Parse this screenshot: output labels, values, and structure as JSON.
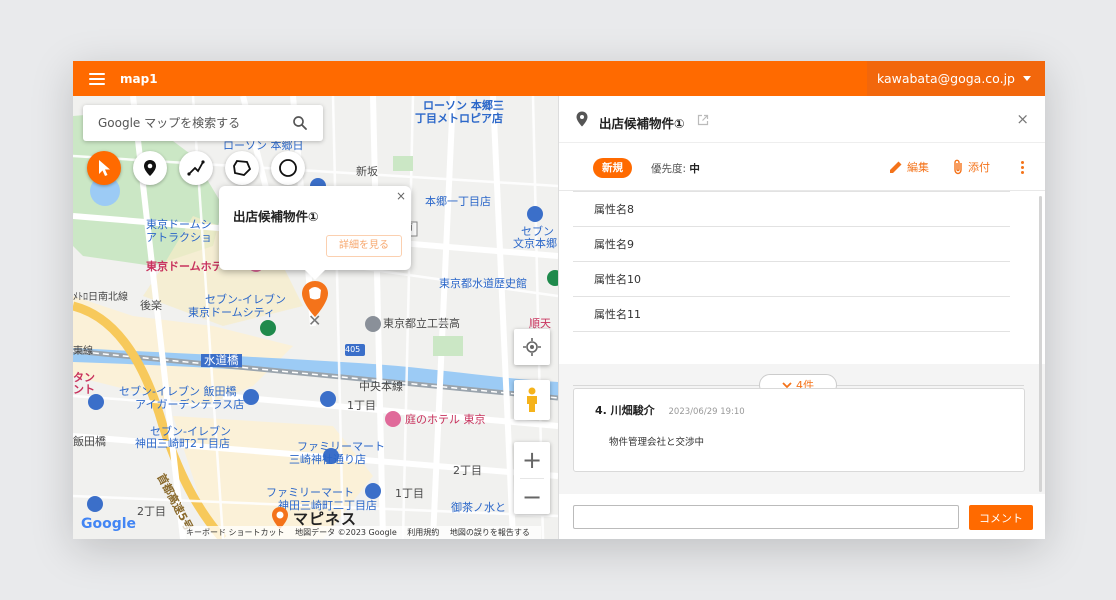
{
  "header": {
    "map_name": "map1",
    "user_email": "kawabata@goga.co.jp"
  },
  "map": {
    "search_placeholder": "Google マップを検索する",
    "tools": [
      "cursor-icon",
      "pin-icon",
      "polyline-icon",
      "polygon-icon",
      "circle-icon"
    ],
    "labels": [
      "ローソン 本郷三",
      "丁目メトロピア店",
      "ローソン 本郷日",
      "東京ドームシ",
      "アトラクショ",
      "東京ドームホテ",
      "新坂",
      "本郷一丁目店",
      "セブン",
      "文京本郷",
      "東京都水道歴史館",
      "後楽",
      "セブン-イレブン",
      "東京ドームシティ",
      "東京都立工芸高",
      "順天",
      "水道橋",
      "中央本線",
      "タン",
      "ント",
      "セブン-イレブン 飯田橋",
      "アイガーデンテラス店",
      "1丁目",
      "庭のホテル 東京",
      "セブン-イレブン",
      "神田三崎町2丁目店",
      "ファミリーマート",
      "三崎神社通り店",
      "2丁目",
      "ファミリーマート",
      "神田三崎町二丁目店",
      "1丁目",
      "首都高速5号",
      "2丁目",
      "御茶ノ水と",
      "飯田橋",
      "東線",
      "ﾒﾄﾛ日南北線",
      "番前",
      "405"
    ],
    "infowindow": {
      "title": "出店候補物件①",
      "close": "×",
      "button": "詳細を見る"
    },
    "zoom_in": "+",
    "zoom_out": "−",
    "logo": "Google",
    "brand": "マピネス",
    "attribution": [
      "キーボード ショートカット",
      "地図データ ©2023 Google",
      "利用規約",
      "地図の誤りを報告する"
    ]
  },
  "panel": {
    "title": "出店候補物件①",
    "close": "×",
    "status_badge": "新規",
    "priority_label": "優先度:",
    "priority_value": "中",
    "edit_label": "編集",
    "attach_label": "添付",
    "attributes": [
      "属性名8",
      "属性名9",
      "属性名10",
      "属性名11"
    ],
    "comment_count": "4件",
    "comments": [
      {
        "author": "4. 川畑駿介",
        "time": "2023/06/29 19:10",
        "body": "物件管理会社と交渉中"
      }
    ],
    "comment_button": "コメント"
  },
  "colors": {
    "accent": "#ff6a00",
    "map_water": "#9ccbf5",
    "map_park": "#cbe7c5"
  }
}
